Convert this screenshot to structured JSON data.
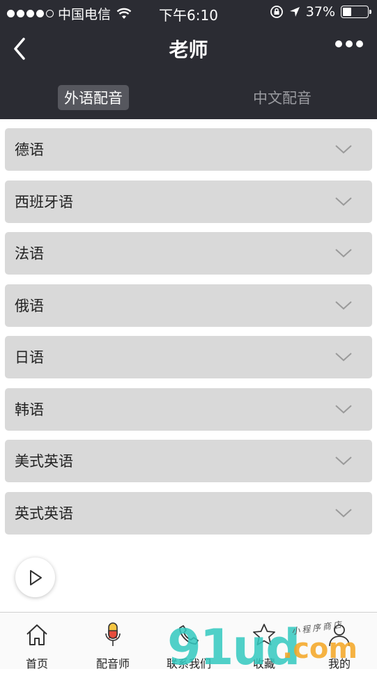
{
  "status_bar": {
    "carrier": "中国电信",
    "time": "下午6:10",
    "battery": "37%",
    "battery_level": 0.37
  },
  "nav": {
    "title": "老师"
  },
  "tabs": [
    {
      "label": "外语配音",
      "active": true
    },
    {
      "label": "中文配音",
      "active": false
    }
  ],
  "languages": [
    {
      "label": "德语"
    },
    {
      "label": "西班牙语"
    },
    {
      "label": "法语"
    },
    {
      "label": "俄语"
    },
    {
      "label": "日语"
    },
    {
      "label": "韩语"
    },
    {
      "label": "美式英语"
    },
    {
      "label": "英式英语"
    }
  ],
  "bottom_nav": [
    {
      "label": "首页",
      "icon": "home-icon"
    },
    {
      "label": "配音师",
      "icon": "microphone-icon"
    },
    {
      "label": "联系我们",
      "icon": "phone-icon"
    },
    {
      "label": "收藏",
      "icon": "star-icon"
    },
    {
      "label": "我的",
      "icon": "user-icon"
    }
  ],
  "watermark": {
    "digits": "91ud",
    "domain": ".com",
    "tagline": "小程序商店"
  },
  "colors": {
    "header_bg": "#2b2c33",
    "row_bg": "#d9d9d9",
    "watermark_teal": "#33c9c0",
    "watermark_orange": "#f5a623"
  }
}
